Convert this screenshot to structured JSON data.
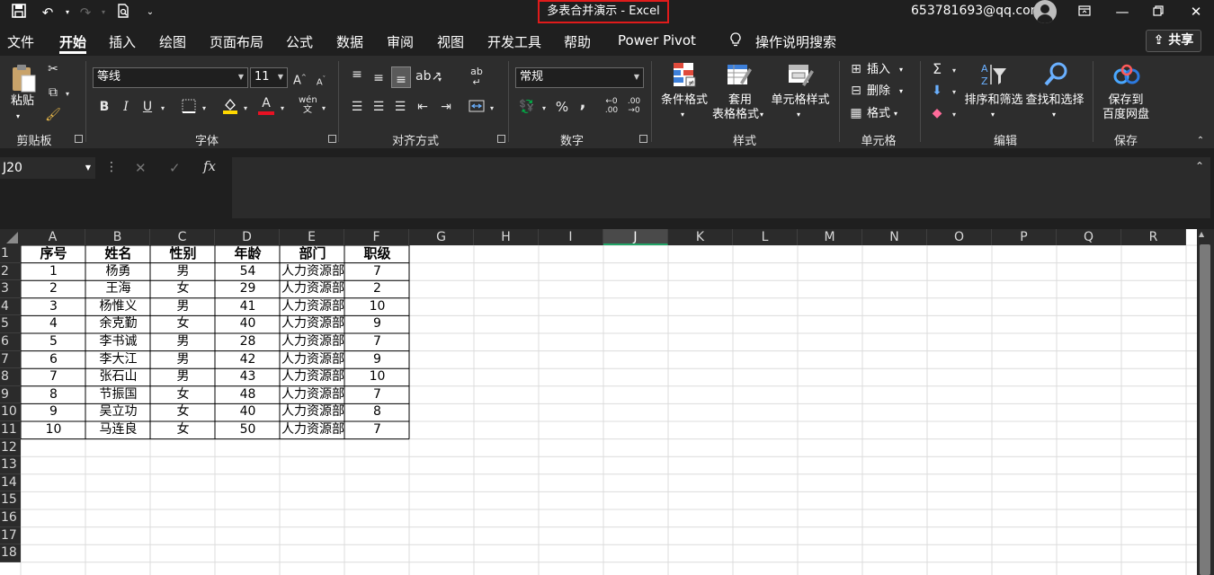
{
  "window": {
    "title": "多表合并演示  -  Excel",
    "account": "653781693@qq.com"
  },
  "tabs": [
    {
      "label": "文件"
    },
    {
      "label": "开始"
    },
    {
      "label": "插入"
    },
    {
      "label": "绘图"
    },
    {
      "label": "页面布局"
    },
    {
      "label": "公式"
    },
    {
      "label": "数据"
    },
    {
      "label": "审阅"
    },
    {
      "label": "视图"
    },
    {
      "label": "开发工具"
    },
    {
      "label": "帮助"
    },
    {
      "label": "Power Pivot"
    },
    {
      "label": "操作说明搜索"
    }
  ],
  "share_label": "共享",
  "ribbon": {
    "clipboard": {
      "paste": "粘贴",
      "group": "剪贴板"
    },
    "font": {
      "name": "等线",
      "size": "11",
      "group": "字体",
      "grow": "A",
      "shrink": "A",
      "bold": "B",
      "italic": "I",
      "underline": "U",
      "color_a": "A"
    },
    "align": {
      "group": "对齐方式"
    },
    "number": {
      "format": "常规",
      "percent": "%",
      "comma": ",",
      "group": "数字"
    },
    "styles": {
      "cond": "条件格式",
      "table1": "套用",
      "table2": "表格格式",
      "cell": "单元格样式",
      "group": "样式"
    },
    "cells": {
      "insert": "插入",
      "delete": "删除",
      "format": "格式",
      "group": "单元格"
    },
    "editing": {
      "sort": "排序和筛选",
      "find": "查找和选择",
      "group": "编辑",
      "sum": "Σ"
    },
    "save": {
      "line1": "保存到",
      "line2": "百度网盘",
      "group": "保存"
    }
  },
  "formula": {
    "namebox": "J20",
    "fx": "fx",
    "value": ""
  },
  "columns": [
    "A",
    "B",
    "C",
    "D",
    "E",
    "F",
    "G",
    "H",
    "I",
    "J",
    "K",
    "L",
    "M",
    "N",
    "O",
    "P",
    "Q",
    "R"
  ],
  "selected_column": "J",
  "rows": [
    "1",
    "2",
    "3",
    "4",
    "5",
    "6",
    "7",
    "8",
    "9",
    "10",
    "11",
    "12",
    "13",
    "14",
    "15",
    "16",
    "17",
    "18"
  ],
  "table": {
    "headers": [
      "序号",
      "姓名",
      "性别",
      "年龄",
      "部门",
      "职级"
    ],
    "data": [
      [
        "1",
        "杨勇",
        "男",
        "54",
        "人力资源部",
        "7"
      ],
      [
        "2",
        "王海",
        "女",
        "29",
        "人力资源部",
        "2"
      ],
      [
        "3",
        "杨惟义",
        "男",
        "41",
        "人力资源部",
        "10"
      ],
      [
        "4",
        "余克勤",
        "女",
        "40",
        "人力资源部",
        "9"
      ],
      [
        "5",
        "李书诚",
        "男",
        "28",
        "人力资源部",
        "7"
      ],
      [
        "6",
        "李大江",
        "男",
        "42",
        "人力资源部",
        "9"
      ],
      [
        "7",
        "张石山",
        "男",
        "43",
        "人力资源部",
        "10"
      ],
      [
        "8",
        "节振国",
        "女",
        "48",
        "人力资源部",
        "7"
      ],
      [
        "9",
        "吴立功",
        "女",
        "40",
        "人力资源部",
        "8"
      ],
      [
        "10",
        "马连良",
        "女",
        "50",
        "人力资源部",
        "7"
      ]
    ]
  },
  "colors": {
    "accent": "#21a366",
    "title_border": "#e01b1b",
    "highlight_yellow": "#ffd800",
    "font_red": "#e81123"
  }
}
